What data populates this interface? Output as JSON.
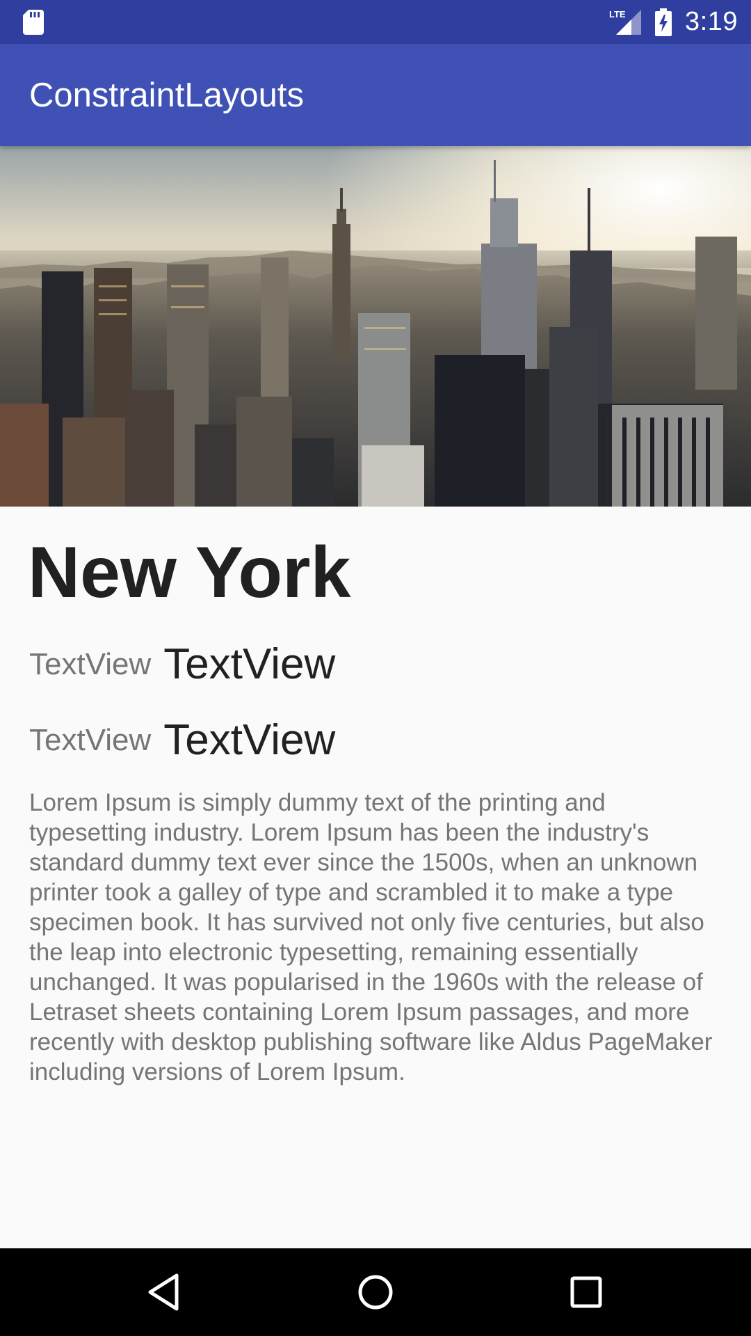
{
  "status_bar": {
    "time": "3:19",
    "network_label": "LTE",
    "icons": [
      "sd-card-icon",
      "lte-signal-icon",
      "battery-charging-icon"
    ]
  },
  "app_bar": {
    "title": "ConstraintLayouts"
  },
  "hero_image": {
    "subject": "city-skyline-photo"
  },
  "content": {
    "city_title": "New York",
    "rows": [
      {
        "label": "TextView",
        "value": "TextView"
      },
      {
        "label": "TextView",
        "value": "TextView"
      }
    ],
    "description": "Lorem Ipsum is simply dummy text of the printing and typesetting industry. Lorem Ipsum has been the industry's standard dummy text ever since the 1500s, when an unknown printer took a galley of type and scrambled it to make a type specimen book. It has survived not only five centuries, but also the leap into electronic typesetting, remaining essentially unchanged. It was popularised in the 1960s with the release of Letraset sheets containing Lorem Ipsum passages, and more recently with desktop publishing software like Aldus PageMaker including versions of Lorem Ipsum."
  },
  "nav_bar": {
    "buttons": [
      "back-icon",
      "home-icon",
      "recents-icon"
    ]
  },
  "colors": {
    "status_bar": "#303f9f",
    "app_bar": "#3f51b5",
    "background": "#fafafa",
    "primary_text": "#212121",
    "secondary_text": "#757575",
    "nav_bar": "#000000"
  }
}
